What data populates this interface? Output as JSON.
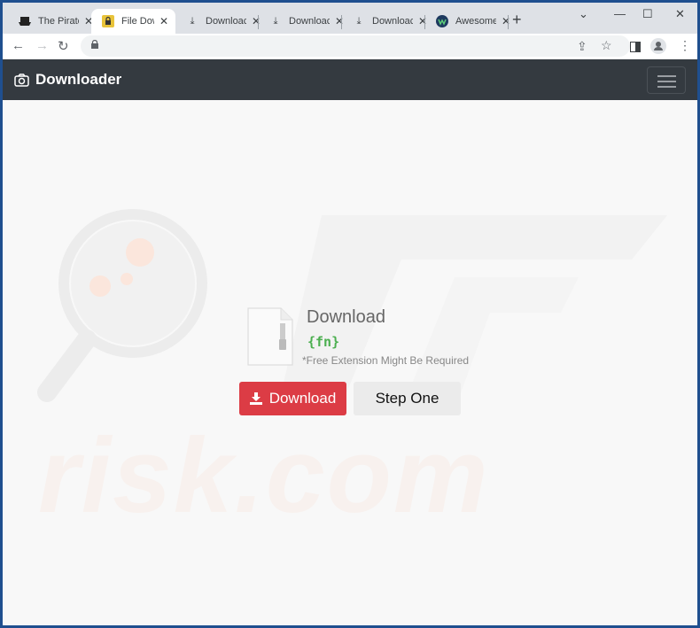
{
  "browser": {
    "tabs": [
      {
        "label": "The Pirate",
        "icon": "pirate-ship-icon",
        "active": false
      },
      {
        "label": "File Down",
        "icon": "padlock-favicon-icon",
        "active": true
      },
      {
        "label": "Downloac",
        "icon": "download-icon",
        "active": false
      },
      {
        "label": "Downloac",
        "icon": "download-icon",
        "active": false
      },
      {
        "label": "Downloac",
        "icon": "download-icon",
        "active": false
      },
      {
        "label": "Awesome",
        "icon": "w-logo-icon",
        "active": false
      }
    ],
    "new_tab": "+",
    "window_controls": {
      "chevron": "⌄",
      "minimize": "—",
      "maximize": "☐",
      "close": "✕"
    },
    "nav": {
      "back": "←",
      "forward": "→",
      "reload": "↻"
    },
    "url": ""
  },
  "site": {
    "brand": "Downloader",
    "download_title": "Download",
    "filename": "{fn}",
    "note": "*Free Extension Might Be Required",
    "download_button": "Download",
    "step_button": "Step One",
    "colors": {
      "navbar": "#343a40",
      "download_button": "#dc3c45",
      "filename": "#4caf50"
    }
  },
  "watermark": "risk.com"
}
